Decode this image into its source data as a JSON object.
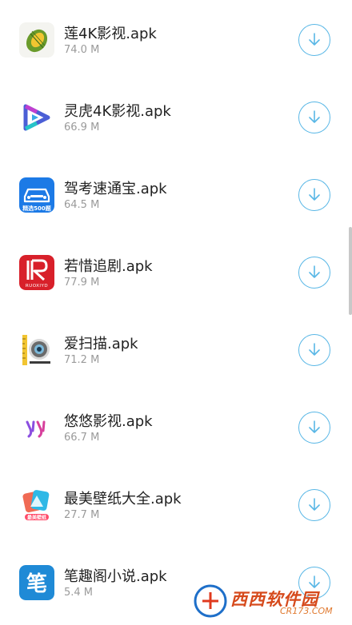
{
  "downloads": {
    "items": [
      {
        "name": "莲4K影视.apk",
        "size": "74.0 M",
        "icon": "durian-icon"
      },
      {
        "name": "灵虎4K影视.apk",
        "size": "66.9 M",
        "icon": "play-triangle-icon"
      },
      {
        "name": "驾考速通宝.apk",
        "size": "64.5 M",
        "icon": "car-icon"
      },
      {
        "name": "若惜追剧.apk",
        "size": "77.9 M",
        "icon": "ruoxi-logo-icon"
      },
      {
        "name": "爱扫描.apk",
        "size": "71.2 M",
        "icon": "camera-lens-icon"
      },
      {
        "name": "悠悠影视.apk",
        "size": "66.7 M",
        "icon": "youyou-logo-icon"
      },
      {
        "name": "最美壁纸大全.apk",
        "size": "27.7 M",
        "icon": "wallpaper-icon"
      },
      {
        "name": "笔趣阁小说.apk",
        "size": "5.4 M",
        "icon": "brush-character-icon"
      }
    ],
    "download_icon": "download-arrow-icon"
  },
  "icon_texts": {
    "car_badge": "精选500题",
    "ruoxi_caption": "RUOXIYD",
    "wallpaper_badge": "最美壁纸",
    "biquge_char": "笔"
  },
  "watermark": {
    "title": "西西软件园",
    "subtitle": "CR173.COM"
  },
  "colors": {
    "accent": "#59b7e6",
    "name_text": "#222222",
    "size_text": "#9a9a9a"
  }
}
